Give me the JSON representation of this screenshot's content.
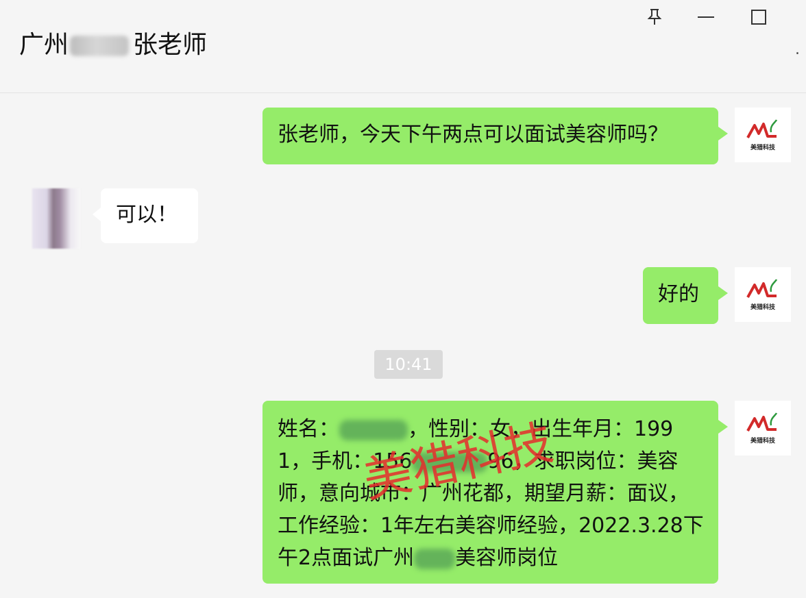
{
  "window": {
    "title_prefix": "广州",
    "title_suffix": "张老师",
    "more_label": "."
  },
  "icons": {
    "pin": "pin-icon",
    "minimize": "minimize-icon",
    "maximize": "maximize-icon",
    "more": "more-icon"
  },
  "messages": [
    {
      "sender": "me",
      "text": "张老师，今天下午两点可以面试美容师吗？"
    },
    {
      "sender": "them",
      "text": "可以！"
    },
    {
      "sender": "me",
      "text": "好的"
    }
  ],
  "timestamp": "10:41",
  "resume_message": {
    "part1": "姓名：",
    "part2": "，性别：女，出生年月：1991，手机：156",
    "part3": "96",
    "part4": "，求职岗位：美容师，意向城市：广州花都，期望月薪：面议，工作经验：1年左右美容师经验，2022.3.28下午2点面试广州",
    "part5": "美容师岗位"
  },
  "avatar_logo": {
    "mark": "ML",
    "name": "美猎科技"
  },
  "watermark": "美猎科技",
  "colors": {
    "my_bubble": "#95ec69",
    "their_bubble": "#ffffff",
    "background": "#f5f5f5",
    "watermark": "#e62d2d",
    "logo_red": "#d22a2a",
    "logo_green": "#2e9a3e"
  }
}
